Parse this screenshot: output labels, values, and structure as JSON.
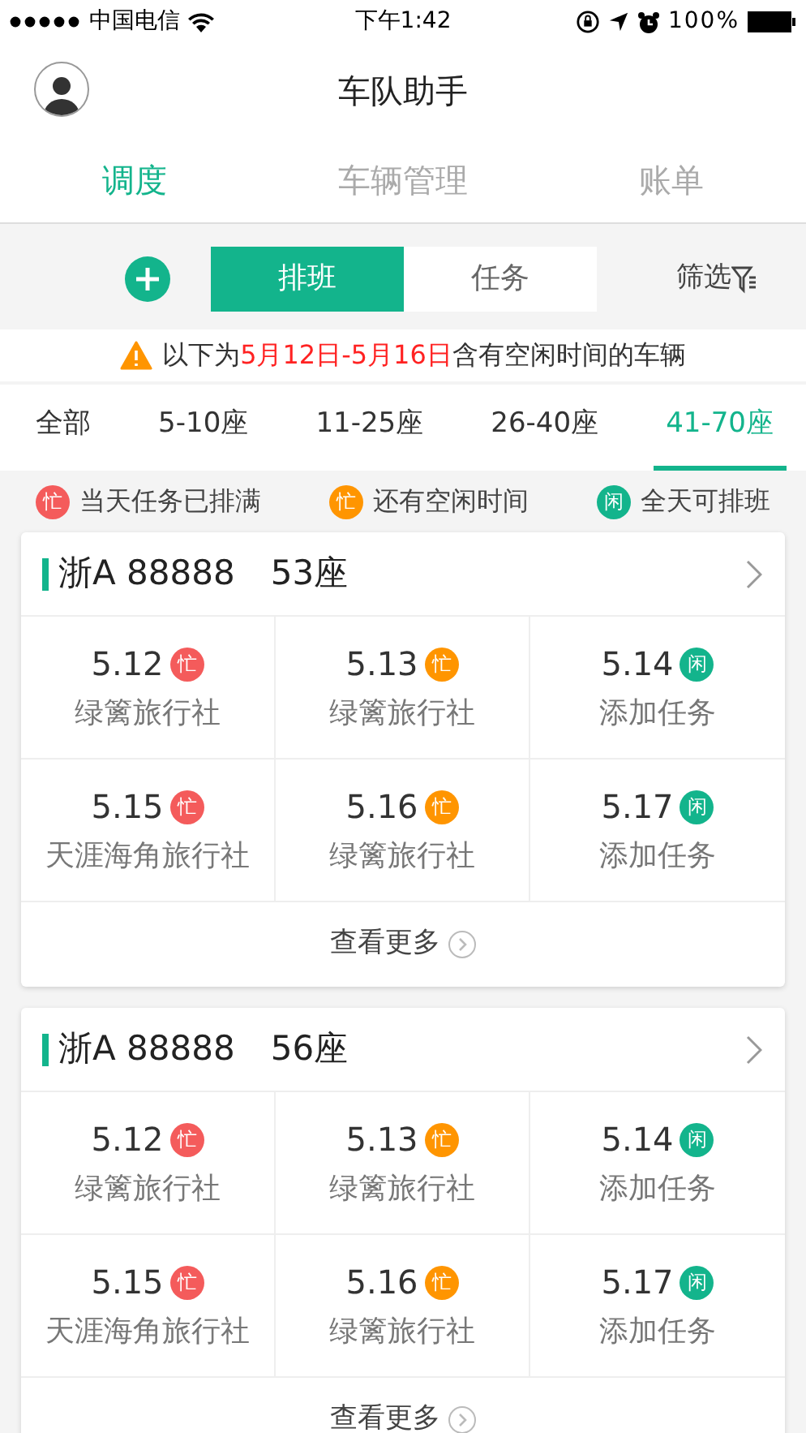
{
  "status_bar": {
    "carrier": "中国电信",
    "time": "下午1:42",
    "battery": "100%"
  },
  "header": {
    "title": "车队助手"
  },
  "nav_tabs": [
    {
      "label": "调度",
      "selected": true
    },
    {
      "label": "车辆管理",
      "selected": false
    },
    {
      "label": "账单",
      "selected": false
    }
  ],
  "segments": [
    {
      "label": "排班",
      "selected": true
    },
    {
      "label": "任务",
      "selected": false
    }
  ],
  "filter": {
    "label": "筛选"
  },
  "notice": {
    "prefix": "以下为",
    "highlight": "5月12日-5月16日",
    "suffix": "含有空闲时间的车辆"
  },
  "seat_tabs": [
    {
      "label": "全部",
      "selected": false
    },
    {
      "label": "5-10座",
      "selected": false
    },
    {
      "label": "11-25座",
      "selected": false
    },
    {
      "label": "26-40座",
      "selected": false
    },
    {
      "label": "41-70座",
      "selected": true
    }
  ],
  "legend": [
    {
      "badge": "忙",
      "label": "当天任务已排满",
      "color": "#f45b5b"
    },
    {
      "badge": "忙",
      "label": "还有空闲时间",
      "color": "#ff9500"
    },
    {
      "badge": "闲",
      "label": "全天可排班",
      "color": "#13b48c"
    }
  ],
  "vehicles": [
    {
      "plate": "浙A 88888",
      "seats": "53座",
      "more": "查看更多",
      "days": [
        {
          "date": "5.12",
          "badge": "忙",
          "color": "#f45b5b",
          "text": "绿篱旅行社"
        },
        {
          "date": "5.13",
          "badge": "忙",
          "color": "#ff9500",
          "text": "绿篱旅行社"
        },
        {
          "date": "5.14",
          "badge": "闲",
          "color": "#13b48c",
          "text": "添加任务"
        },
        {
          "date": "5.15",
          "badge": "忙",
          "color": "#f45b5b",
          "text": "天涯海角旅行社"
        },
        {
          "date": "5.16",
          "badge": "忙",
          "color": "#ff9500",
          "text": "绿篱旅行社"
        },
        {
          "date": "5.17",
          "badge": "闲",
          "color": "#13b48c",
          "text": "添加任务"
        }
      ]
    },
    {
      "plate": "浙A 88888",
      "seats": "56座",
      "more": "查看更多",
      "days": [
        {
          "date": "5.12",
          "badge": "忙",
          "color": "#f45b5b",
          "text": "绿篱旅行社"
        },
        {
          "date": "5.13",
          "badge": "忙",
          "color": "#ff9500",
          "text": "绿篱旅行社"
        },
        {
          "date": "5.14",
          "badge": "闲",
          "color": "#13b48c",
          "text": "添加任务"
        },
        {
          "date": "5.15",
          "badge": "忙",
          "color": "#f45b5b",
          "text": "天涯海角旅行社"
        },
        {
          "date": "5.16",
          "badge": "忙",
          "color": "#ff9500",
          "text": "绿篱旅行社"
        },
        {
          "date": "5.17",
          "badge": "闲",
          "color": "#13b48c",
          "text": "添加任务"
        }
      ]
    }
  ]
}
